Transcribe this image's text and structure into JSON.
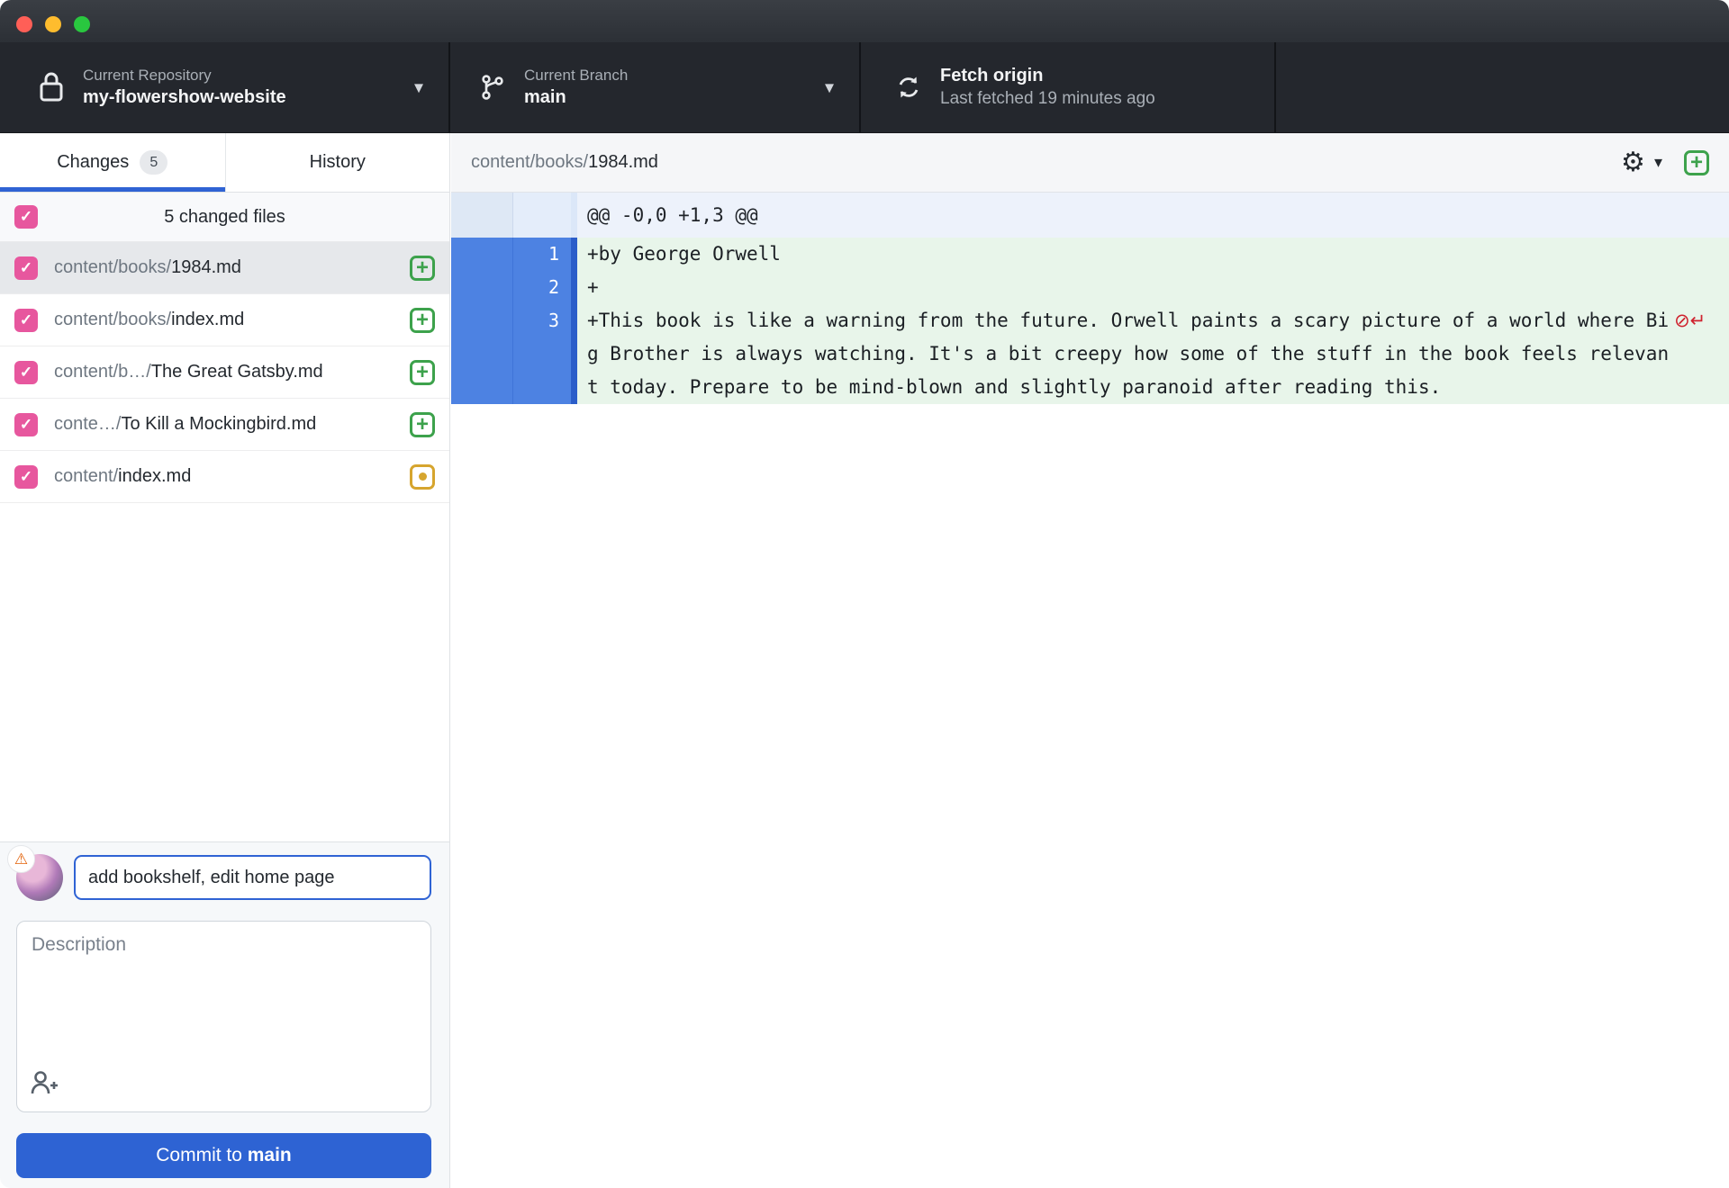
{
  "colors": {
    "accent-blue": "#2f63d4",
    "button-blue": "#2e63d3",
    "accent-pink": "#e7579e",
    "status-green": "#3da24c",
    "status-yellow": "#d6a52e",
    "gutter-blue": "#4d82e2",
    "added-green": "#e8f5ea",
    "danger-red": "#cf222e"
  },
  "glyphs": {
    "caret_down": "▾",
    "gear": "⚙",
    "check": "✓",
    "plus": "+",
    "warning": "⚠",
    "no_newline": "⊘↵"
  },
  "toolbar": {
    "repository": {
      "label": "Current Repository",
      "value": "my-flowershow-website"
    },
    "branch": {
      "label": "Current Branch",
      "value": "main"
    },
    "fetch": {
      "title": "Fetch origin",
      "subtitle": "Last fetched 19 minutes ago"
    }
  },
  "sidebar": {
    "tabs": [
      {
        "label": "Changes",
        "badge": "5"
      },
      {
        "label": "History"
      }
    ],
    "select_all_label": "5 changed files",
    "files": [
      {
        "path_prefix": "content/books/",
        "name": "1984.md",
        "status": "added"
      },
      {
        "path_prefix": "content/books/",
        "name": "index.md",
        "status": "added"
      },
      {
        "path_prefix": "content/b…/",
        "name": "The Great Gatsby.md",
        "status": "added"
      },
      {
        "path_prefix": "conte…/",
        "name": "To Kill a Mockingbird.md",
        "status": "added"
      },
      {
        "path_prefix": "content/",
        "name": "index.md",
        "status": "modified"
      }
    ],
    "commit": {
      "summary_value": "add bookshelf, edit home page",
      "description_placeholder": "Description",
      "button_prefix": "Commit to ",
      "button_branch": "main"
    }
  },
  "diff": {
    "file_path_prefix": "content/books/",
    "file_name": "1984.md",
    "hunk_header": "@@ -0,0 +1,3 @@",
    "lines": [
      {
        "new_number": "1",
        "text": "+by George Orwell"
      },
      {
        "new_number": "2",
        "text": "+"
      },
      {
        "new_number": "3",
        "text": "+This book is like a warning from the future. Orwell paints a scary picture of a world where Big Brother is always watching. It's a bit creepy how some of the stuff in the book feels relevant today. Prepare to be mind-blown and slightly paranoid after reading this."
      }
    ]
  }
}
